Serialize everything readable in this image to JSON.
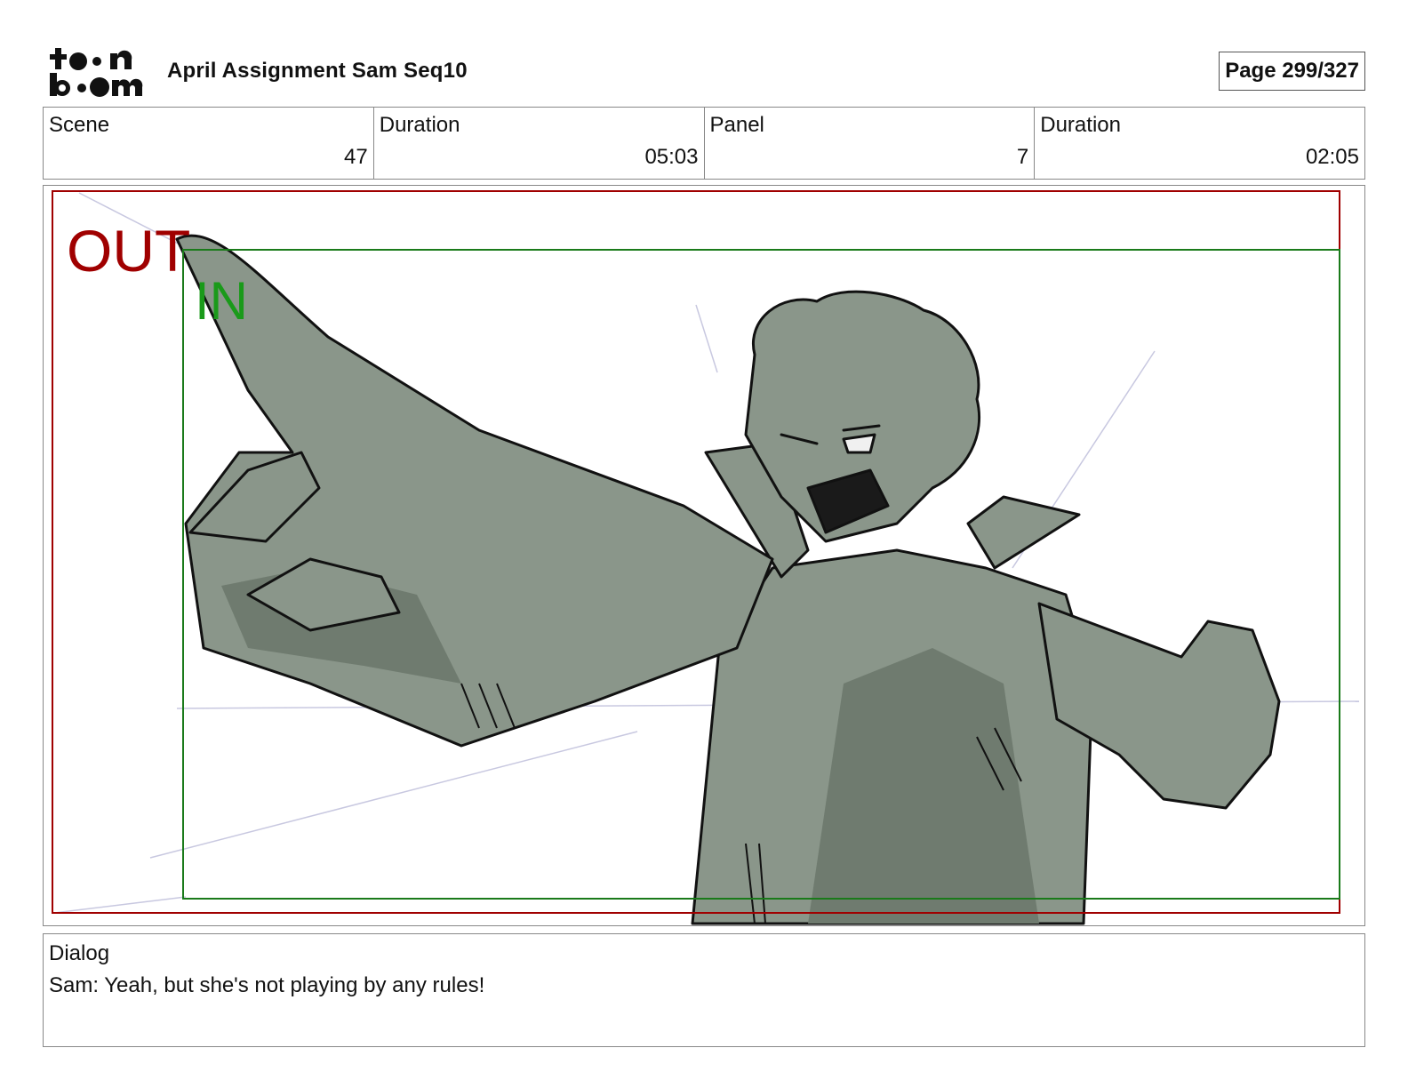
{
  "header": {
    "logo_text": "toon boom",
    "title": "April Assignment Sam Seq10",
    "page": "Page 299/327"
  },
  "info": {
    "scene_label": "Scene",
    "scene_value": "47",
    "scene_duration_label": "Duration",
    "scene_duration_value": "05:03",
    "panel_label": "Panel",
    "panel_value": "7",
    "panel_duration_label": "Duration",
    "panel_duration_value": "02:05"
  },
  "panel": {
    "out_label": "OUT",
    "in_label": "IN",
    "out_color": "#a00000",
    "in_color": "#1a9a1a",
    "figure_fill": "#8a968a",
    "figure_shadow": "#6f7b6f"
  },
  "dialog": {
    "label": "Dialog",
    "text": "Sam: Yeah, but she's not playing by any rules!"
  }
}
